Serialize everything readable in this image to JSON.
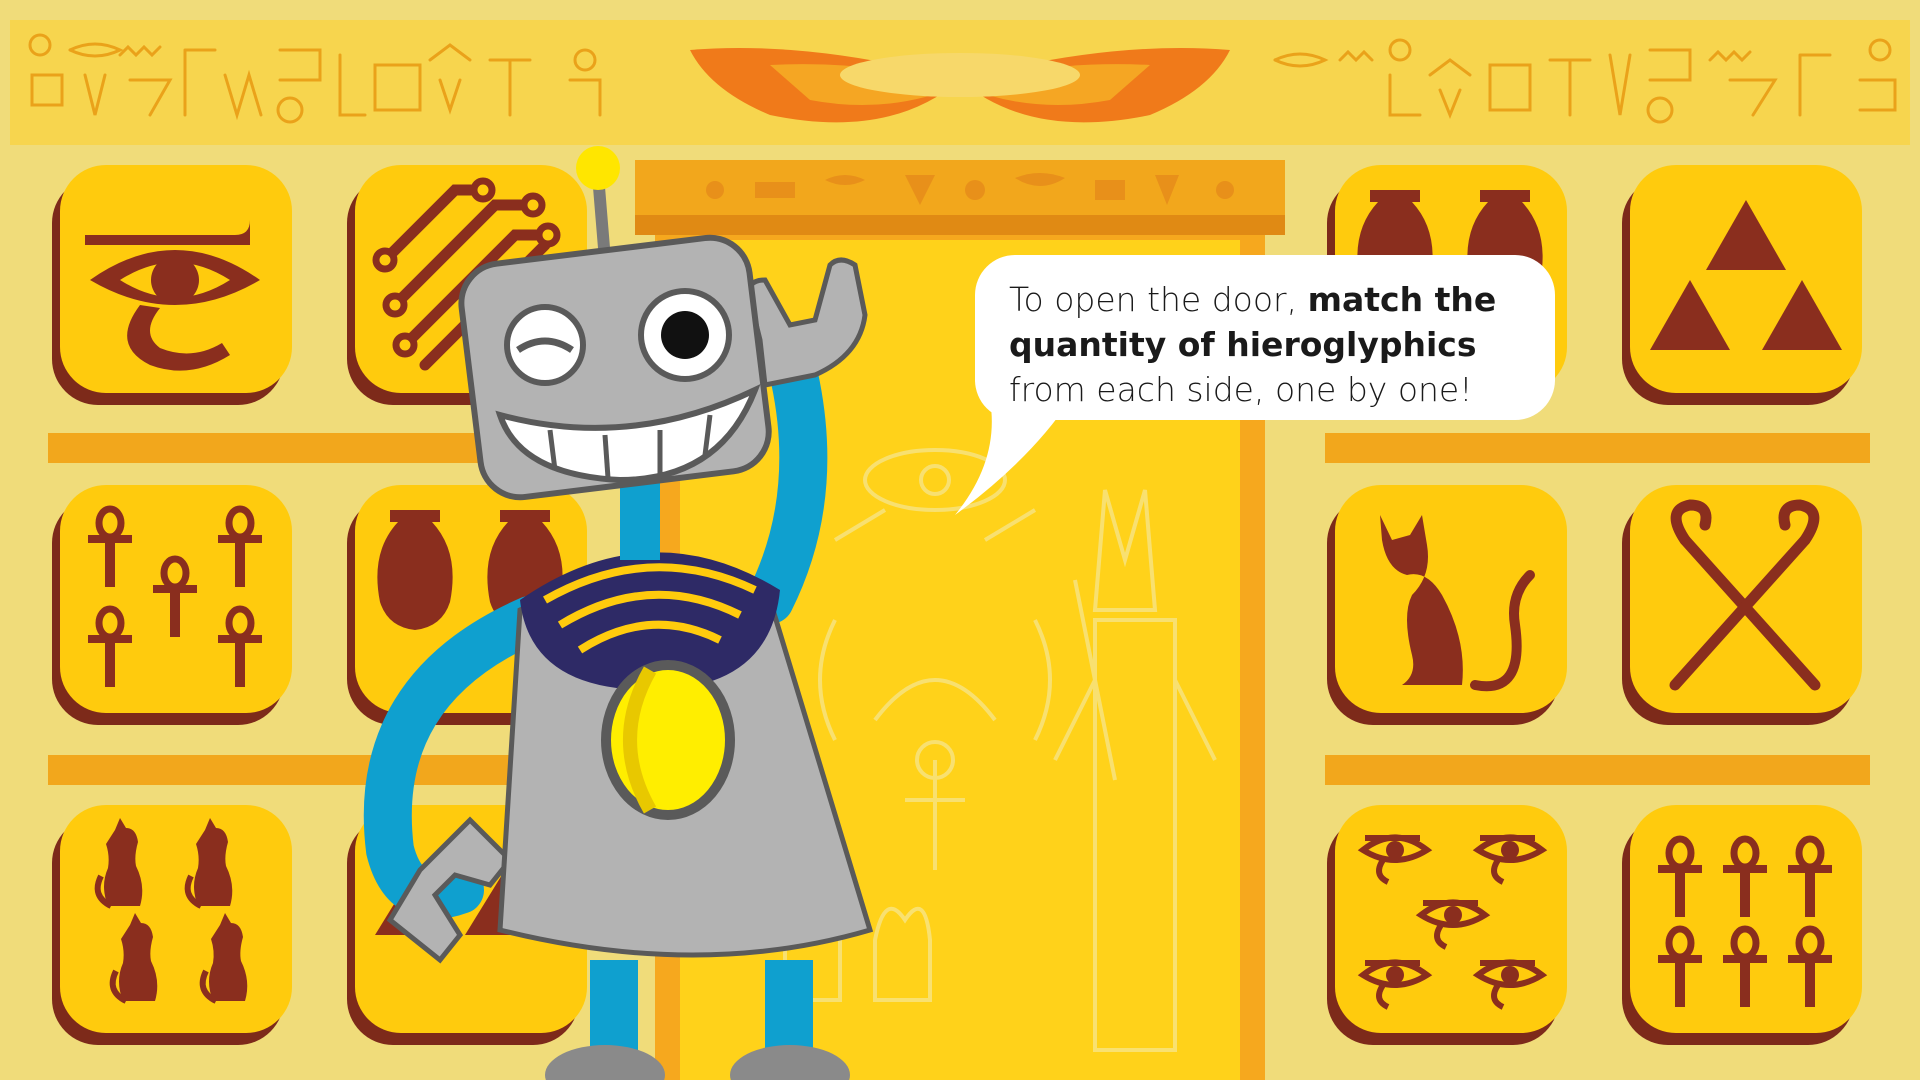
{
  "dialog": {
    "speaker": "robot",
    "part1": "To open the door, ",
    "bold": "match the quantity of hieroglyphics",
    "part2": " from each side, one by one!"
  },
  "tiles": {
    "left": [
      {
        "name": "tile-eye-of-horus",
        "icon": "eye-of-horus-icon",
        "count": 1
      },
      {
        "name": "tile-circuit",
        "icon": "circuit-lines-icon",
        "count": 4
      },
      {
        "name": "tile-ankhs",
        "icon": "ankh-icon",
        "count": 5
      },
      {
        "name": "tile-vases",
        "icon": "vase-icon",
        "count": 2
      },
      {
        "name": "tile-cats",
        "icon": "cat-icon",
        "count": 4
      },
      {
        "name": "tile-triangles",
        "icon": "triangle-icon",
        "count": 2
      }
    ],
    "right": [
      {
        "name": "tile-vases",
        "icon": "vase-icon",
        "count": 2
      },
      {
        "name": "tile-triangles",
        "icon": "triangle-icon",
        "count": 3
      },
      {
        "name": "tile-cat",
        "icon": "cat-icon",
        "count": 1
      },
      {
        "name": "tile-crossed-staffs",
        "icon": "crossed-staffs-icon",
        "count": 2
      },
      {
        "name": "tile-eyes",
        "icon": "eye-of-horus-icon",
        "count": 5
      },
      {
        "name": "tile-ankhs",
        "icon": "ankh-icon",
        "count": 6
      }
    ]
  },
  "colors": {
    "background": "#f0dc7a",
    "tile_face": "#ffcb0d",
    "tile_shadow": "#7d2a1a",
    "glyph": "#8a2e1e",
    "door": "#ffd21a",
    "door_frame": "#f2a71c",
    "robot_body": "#b3b3b3",
    "robot_limbs": "#0fa0cf",
    "robot_chest_light": "#ffee00"
  }
}
